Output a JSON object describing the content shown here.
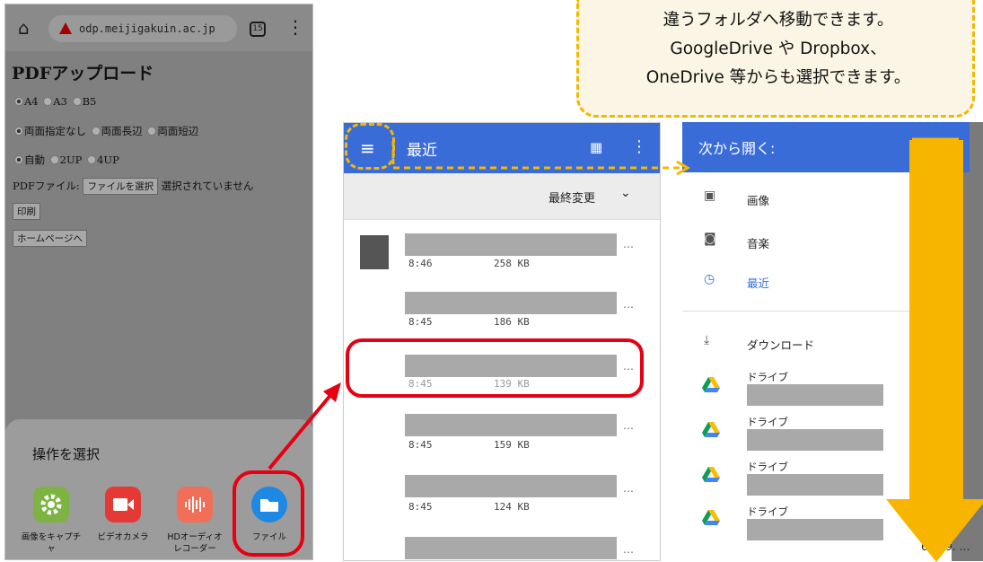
{
  "panel1": {
    "url": "odp.meijigakuin.ac.jp",
    "tab_count": "15",
    "page_title": "PDFアップロード",
    "paper": [
      "A4",
      "A3",
      "B5"
    ],
    "duplex": [
      "両面指定なし",
      "両面長辺",
      "両面短辺"
    ],
    "layout": [
      "自動",
      "2UP",
      "4UP"
    ],
    "file_label": "PDFファイル:",
    "file_button": "ファイルを選択",
    "file_status": "選択されていません",
    "print_button": "印刷",
    "home_button": "ホームページへ",
    "sheet_title": "操作を選択",
    "apps": [
      {
        "label": "画像をキャプチャ",
        "color": "#7cb342",
        "icon": "gear-icon"
      },
      {
        "label": "ビデオカメラ",
        "color": "#e53935",
        "icon": "video-camera-icon"
      },
      {
        "label": "HDオーディオレコーダー",
        "color": "#f16f58",
        "icon": "waveform-icon"
      },
      {
        "label": "ファイル",
        "color": "#1e88e5",
        "icon": "folder-icon"
      }
    ]
  },
  "panel2": {
    "title": "最近",
    "sort_label": "最終変更",
    "files": [
      {
        "time": "8:46",
        "size": "258 KB"
      },
      {
        "time": "8:45",
        "size": "186 KB"
      },
      {
        "time": "8:45",
        "size": "139 KB"
      },
      {
        "time": "8:45",
        "size": "159 KB"
      },
      {
        "time": "8:45",
        "size": "124 KB"
      }
    ],
    "more": "…"
  },
  "panel3": {
    "title": "次から開く:",
    "items": [
      {
        "label": "画像",
        "icon": "image-icon"
      },
      {
        "label": "音楽",
        "icon": "music-icon"
      },
      {
        "label": "最近",
        "icon": "clock-icon"
      },
      {
        "label": "ダウンロード",
        "icon": "download-icon"
      },
      {
        "label": "ドライブ",
        "icon": "google-drive-icon"
      },
      {
        "label": "ドライブ",
        "icon": "google-drive-icon"
      },
      {
        "label": "ドライブ",
        "icon": "google-drive-icon"
      },
      {
        "label": "ドライブ",
        "icon": "google-drive-icon"
      }
    ],
    "bg_text": "64-49. …"
  },
  "callout": {
    "line1": "違うフォルダへ移動できます。",
    "line2": "GoogleDrive や Dropbox、",
    "line3": "OneDrive 等からも選択できます。"
  },
  "colors": {
    "accent_blue": "#3a6cd8",
    "highlight_red": "#e60012",
    "callout_yellow": "#f5b800"
  }
}
